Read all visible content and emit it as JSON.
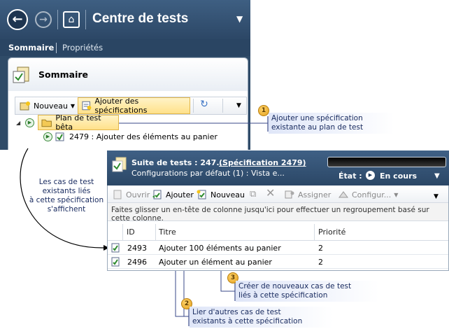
{
  "top_window": {
    "title": "Centre de tests",
    "tabs": [
      {
        "label": "Sommaire"
      },
      {
        "label": "Propriétés"
      }
    ],
    "summary_title": "Sommaire",
    "toolbar": {
      "new_label": "Nouveau",
      "add_specs_label": "Ajouter des spécifications"
    },
    "tree": {
      "root_label": "Plan de test bêta",
      "child_label": "2479 : Ajouter des éléments au panier"
    }
  },
  "callouts": [
    {
      "number": "1",
      "line1": "Ajouter une spécification",
      "line2": "existante au plan de test"
    },
    {
      "number": "2",
      "line1": "Lier d'autres cas de test",
      "line2": "existants à cette spécification"
    },
    {
      "number": "3",
      "line1": "Créer de nouveaux cas de test",
      "line2": "liés à cette spécification"
    }
  ],
  "side_annotation": [
    "Les cas de test",
    "existants liés",
    "à cette spécification",
    "s'affichent"
  ],
  "bottom_window": {
    "suite_label": "Suite de tests :  247...",
    "spec_link": "(Spécification 2479)",
    "config": "Configurations par défaut (1) : Vista e...",
    "etat_label": "État :",
    "etat_value": "En cours",
    "toolbar": {
      "open": "Ouvrir",
      "add": "Ajouter",
      "new": "Nouveau",
      "assign": "Assigner",
      "configure": "Configur..."
    },
    "group_hint": "Faites glisser un en-tête de colonne jusqu'ici pour effectuer un regroupement basé sur cette colonne.",
    "columns": [
      "ID",
      "Titre",
      "Priorité"
    ],
    "rows": [
      {
        "id": "2493",
        "title": "Ajouter 100 éléments au panier",
        "priority": "2"
      },
      {
        "id": "2496",
        "title": "Ajouter un élément au panier",
        "priority": "2"
      }
    ]
  },
  "colors": {
    "header_dark": "#2f4b68",
    "highlight": "#ffe18a",
    "callout_text": "#1a2c60",
    "connector": "#3a4a8a"
  }
}
